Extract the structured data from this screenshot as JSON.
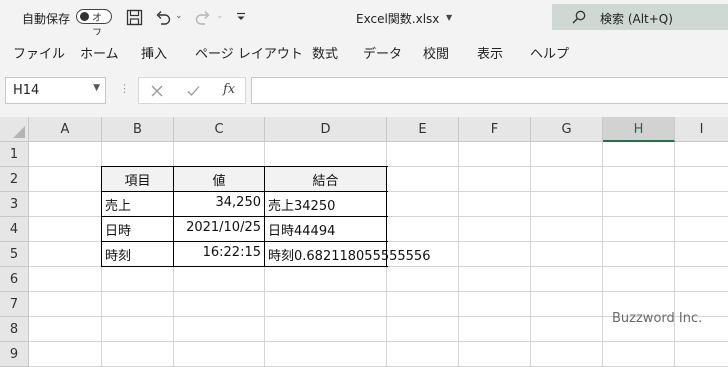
{
  "titlebar": {
    "autosave_label": "自動保存",
    "autosave_state": "オフ",
    "filename": "Excel関数.xlsx",
    "search_label": "検索 (Alt+Q)"
  },
  "ribbon_tabs": [
    "ファイル",
    "ホーム",
    "挿入",
    "ページ レイアウト",
    "数式",
    "データ",
    "校閲",
    "表示",
    "ヘルプ"
  ],
  "formula_bar": {
    "name_box": "H14",
    "fx": "fx",
    "formula": ""
  },
  "columns": [
    "A",
    "B",
    "C",
    "D",
    "E",
    "F",
    "G",
    "H",
    "I"
  ],
  "rows": [
    "1",
    "2",
    "3",
    "4",
    "5",
    "6",
    "7",
    "8",
    "9"
  ],
  "selected_column": "H",
  "table": {
    "headers": [
      "項目",
      "値",
      "結合"
    ],
    "rows": [
      [
        "売上",
        "34,250",
        "売上34250"
      ],
      [
        "日時",
        "2021/10/25",
        "日時44494"
      ],
      [
        "時刻",
        "16:22:15",
        "時刻0.682118055555556"
      ]
    ]
  },
  "colors": {
    "header_fill": "#f2f2f2",
    "accent": "#217346",
    "title_search_bg": "#cfd8d2"
  },
  "icons": [
    "save-icon",
    "undo-icon",
    "redo-icon",
    "customize-qat-icon",
    "search-icon",
    "cancel-icon",
    "enter-icon",
    "insert-function-icon"
  ],
  "watermark": "Buzzword Inc."
}
